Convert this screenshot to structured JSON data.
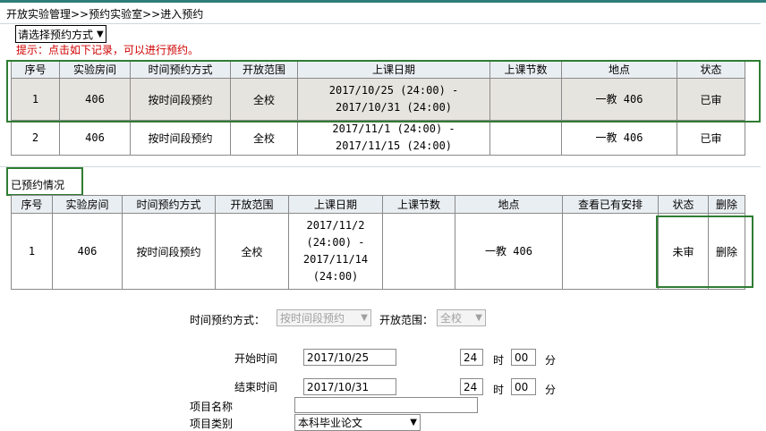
{
  "breadcrumb": "开放实验管理>>预约实验室>>进入预约",
  "mode_select": {
    "value": "请选择预约方式",
    "icon": "chevron-down-icon"
  },
  "hint": "提示：点击如下记录，可以进行预约。",
  "available": {
    "headers": [
      "序号",
      "实验房间",
      "时间预约方式",
      "开放范围",
      "上课日期",
      "上课节数",
      "地点",
      "状态"
    ],
    "rows": [
      {
        "no": "1",
        "room": "406",
        "mode": "按时间段预约",
        "scope": "全校",
        "date_line1": "2017/10/25 (24:00) -",
        "date_line2": "2017/10/31 (24:00)",
        "periods": "",
        "location": "一教 406",
        "status": "已审"
      },
      {
        "no": "2",
        "room": "406",
        "mode": "按时间段预约",
        "scope": "全校",
        "date_line1": "2017/11/1 (24:00) -",
        "date_line2": "2017/11/15 (24:00)",
        "periods": "",
        "location": "一教 406",
        "status": "已审"
      }
    ]
  },
  "booked": {
    "title": "已预约情况",
    "headers": [
      "序号",
      "实验房间",
      "时间预约方式",
      "开放范围",
      "上课日期",
      "上课节数",
      "地点",
      "查看已有安排",
      "状态",
      "删除"
    ],
    "rows": [
      {
        "no": "1",
        "room": "406",
        "mode": "按时间段预约",
        "scope": "全校",
        "date_l1": "2017/11/2",
        "date_l2": "(24:00) -",
        "date_l3": "2017/11/14",
        "date_l4": "(24:00)",
        "periods": "",
        "location": "一教 406",
        "view": "",
        "status": "未审",
        "delete": "删除"
      }
    ]
  },
  "form": {
    "mode_label": "时间预约方式：",
    "mode_value": "按时间段预约",
    "scope_label": "开放范围：",
    "scope_value": "全校",
    "start_label": "开始时间",
    "start_date": "2017/10/25",
    "start_hour": "24",
    "hour_unit": "时",
    "start_min": "00",
    "min_unit": "分",
    "end_label": "结束时间",
    "end_date": "2017/10/31",
    "end_hour": "24",
    "end_min": "00",
    "project_name_label": "项目名称",
    "project_name_value": "",
    "project_type_label": "项目类别",
    "project_type_value": "本科毕业论文"
  },
  "colors": {
    "highlight": "#2f7d32",
    "hint": "#d00000",
    "header_bg": "#e9eef2",
    "row_selected_bg": "#e6e4de"
  }
}
